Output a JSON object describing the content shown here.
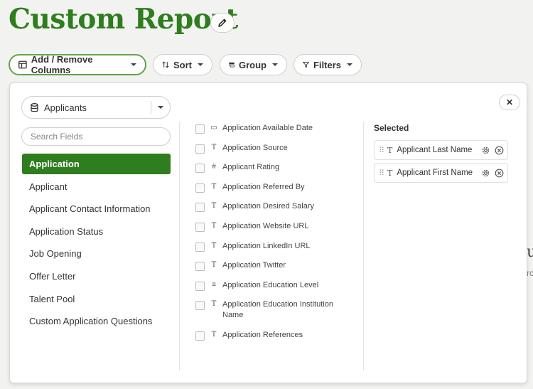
{
  "page": {
    "title": "Custom Report"
  },
  "toolbar": {
    "columns_label": "Add / Remove Columns",
    "sort_label": "Sort",
    "group_label": "Group",
    "filters_label": "Filters"
  },
  "panel": {
    "source": {
      "value": "Applicants"
    },
    "search": {
      "placeholder": "Search Fields"
    },
    "categories": [
      "Application",
      "Applicant",
      "Applicant Contact Information",
      "Application Status",
      "Job Opening",
      "Offer Letter",
      "Talent Pool",
      "Custom Application Questions"
    ],
    "active_category": "Application",
    "fields": [
      {
        "label": "Application Available Date",
        "icon": "calendar-icon"
      },
      {
        "label": "Application Source",
        "icon": "text-icon"
      },
      {
        "label": "Applicant Rating",
        "icon": "number-icon"
      },
      {
        "label": "Application Referred By",
        "icon": "text-icon"
      },
      {
        "label": "Application Desired Salary",
        "icon": "text-icon"
      },
      {
        "label": "Application Website URL",
        "icon": "text-icon"
      },
      {
        "label": "Application LinkedIn URL",
        "icon": "text-icon"
      },
      {
        "label": "Application Twitter",
        "icon": "text-icon"
      },
      {
        "label": "Application Education Level",
        "icon": "list-icon"
      },
      {
        "label": "Application Education Institution Name",
        "icon": "text-icon"
      },
      {
        "label": "Application References",
        "icon": "text-icon"
      }
    ],
    "selected_title": "Selected",
    "selected": [
      {
        "label": "Applicant Last Name"
      },
      {
        "label": "Applicant First Name"
      }
    ]
  },
  "colors": {
    "brand_green": "#2e7d1e",
    "active_border": "#5fa64a"
  }
}
